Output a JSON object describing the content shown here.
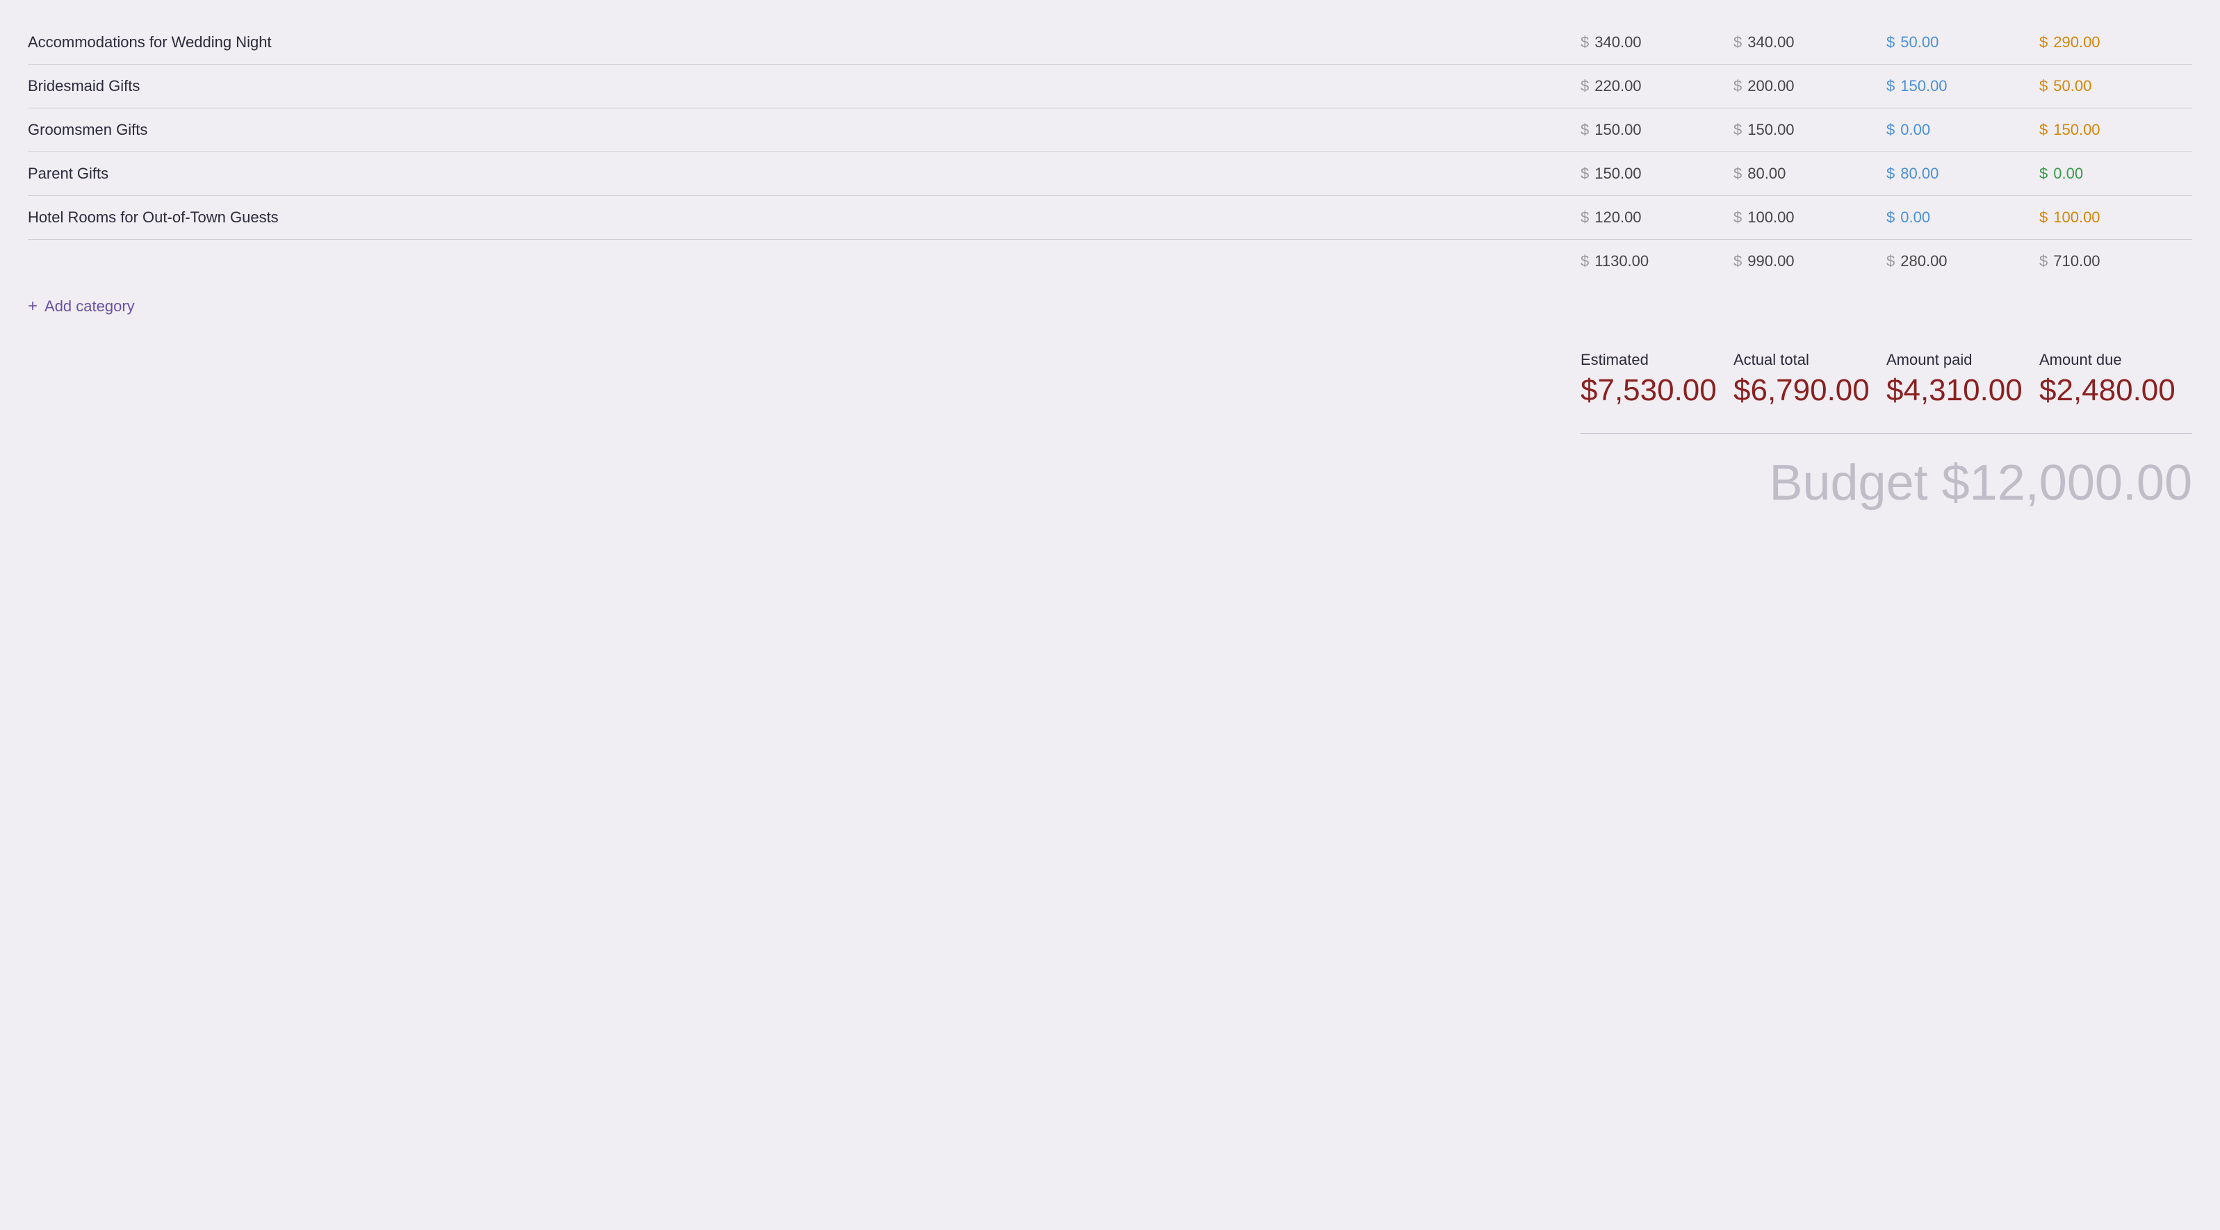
{
  "rows": [
    {
      "name": "Accommodations for Wedding Night",
      "estimated": "340.00",
      "actual": "340.00",
      "paid": "50.00",
      "due": "290.00",
      "due_color": "orange"
    },
    {
      "name": "Bridesmaid Gifts",
      "estimated": "220.00",
      "actual": "200.00",
      "paid": "150.00",
      "due": "50.00",
      "due_color": "orange"
    },
    {
      "name": "Groomsmen Gifts",
      "estimated": "150.00",
      "actual": "150.00",
      "paid": "0.00",
      "due": "150.00",
      "due_color": "orange"
    },
    {
      "name": "Parent Gifts",
      "estimated": "150.00",
      "actual": "80.00",
      "paid": "80.00",
      "due": "0.00",
      "due_color": "green"
    },
    {
      "name": "Hotel Rooms for Out-of-Town Guests",
      "estimated": "120.00",
      "actual": "100.00",
      "paid": "0.00",
      "due": "100.00",
      "due_color": "orange"
    }
  ],
  "totals": {
    "estimated": "1130.00",
    "actual": "990.00",
    "paid": "280.00",
    "due": "710.00"
  },
  "add_category_label": "Add category",
  "summary": {
    "estimated_label": "Estimated",
    "estimated_value": "$7,530.00",
    "actual_label": "Actual total",
    "actual_value": "$6,790.00",
    "paid_label": "Amount paid",
    "paid_value": "$4,310.00",
    "due_label": "Amount due",
    "due_value": "$2,480.00"
  },
  "budget_label": "Budget $12,000.00",
  "dollar_sign": "$",
  "colors": {
    "paid": "#4a90d9",
    "due_orange": "#d4860a",
    "due_green": "#3a9a4a",
    "add_category": "#6b4fa8",
    "summary_value": "#8b2020",
    "budget_total": "#c0bcc8"
  }
}
